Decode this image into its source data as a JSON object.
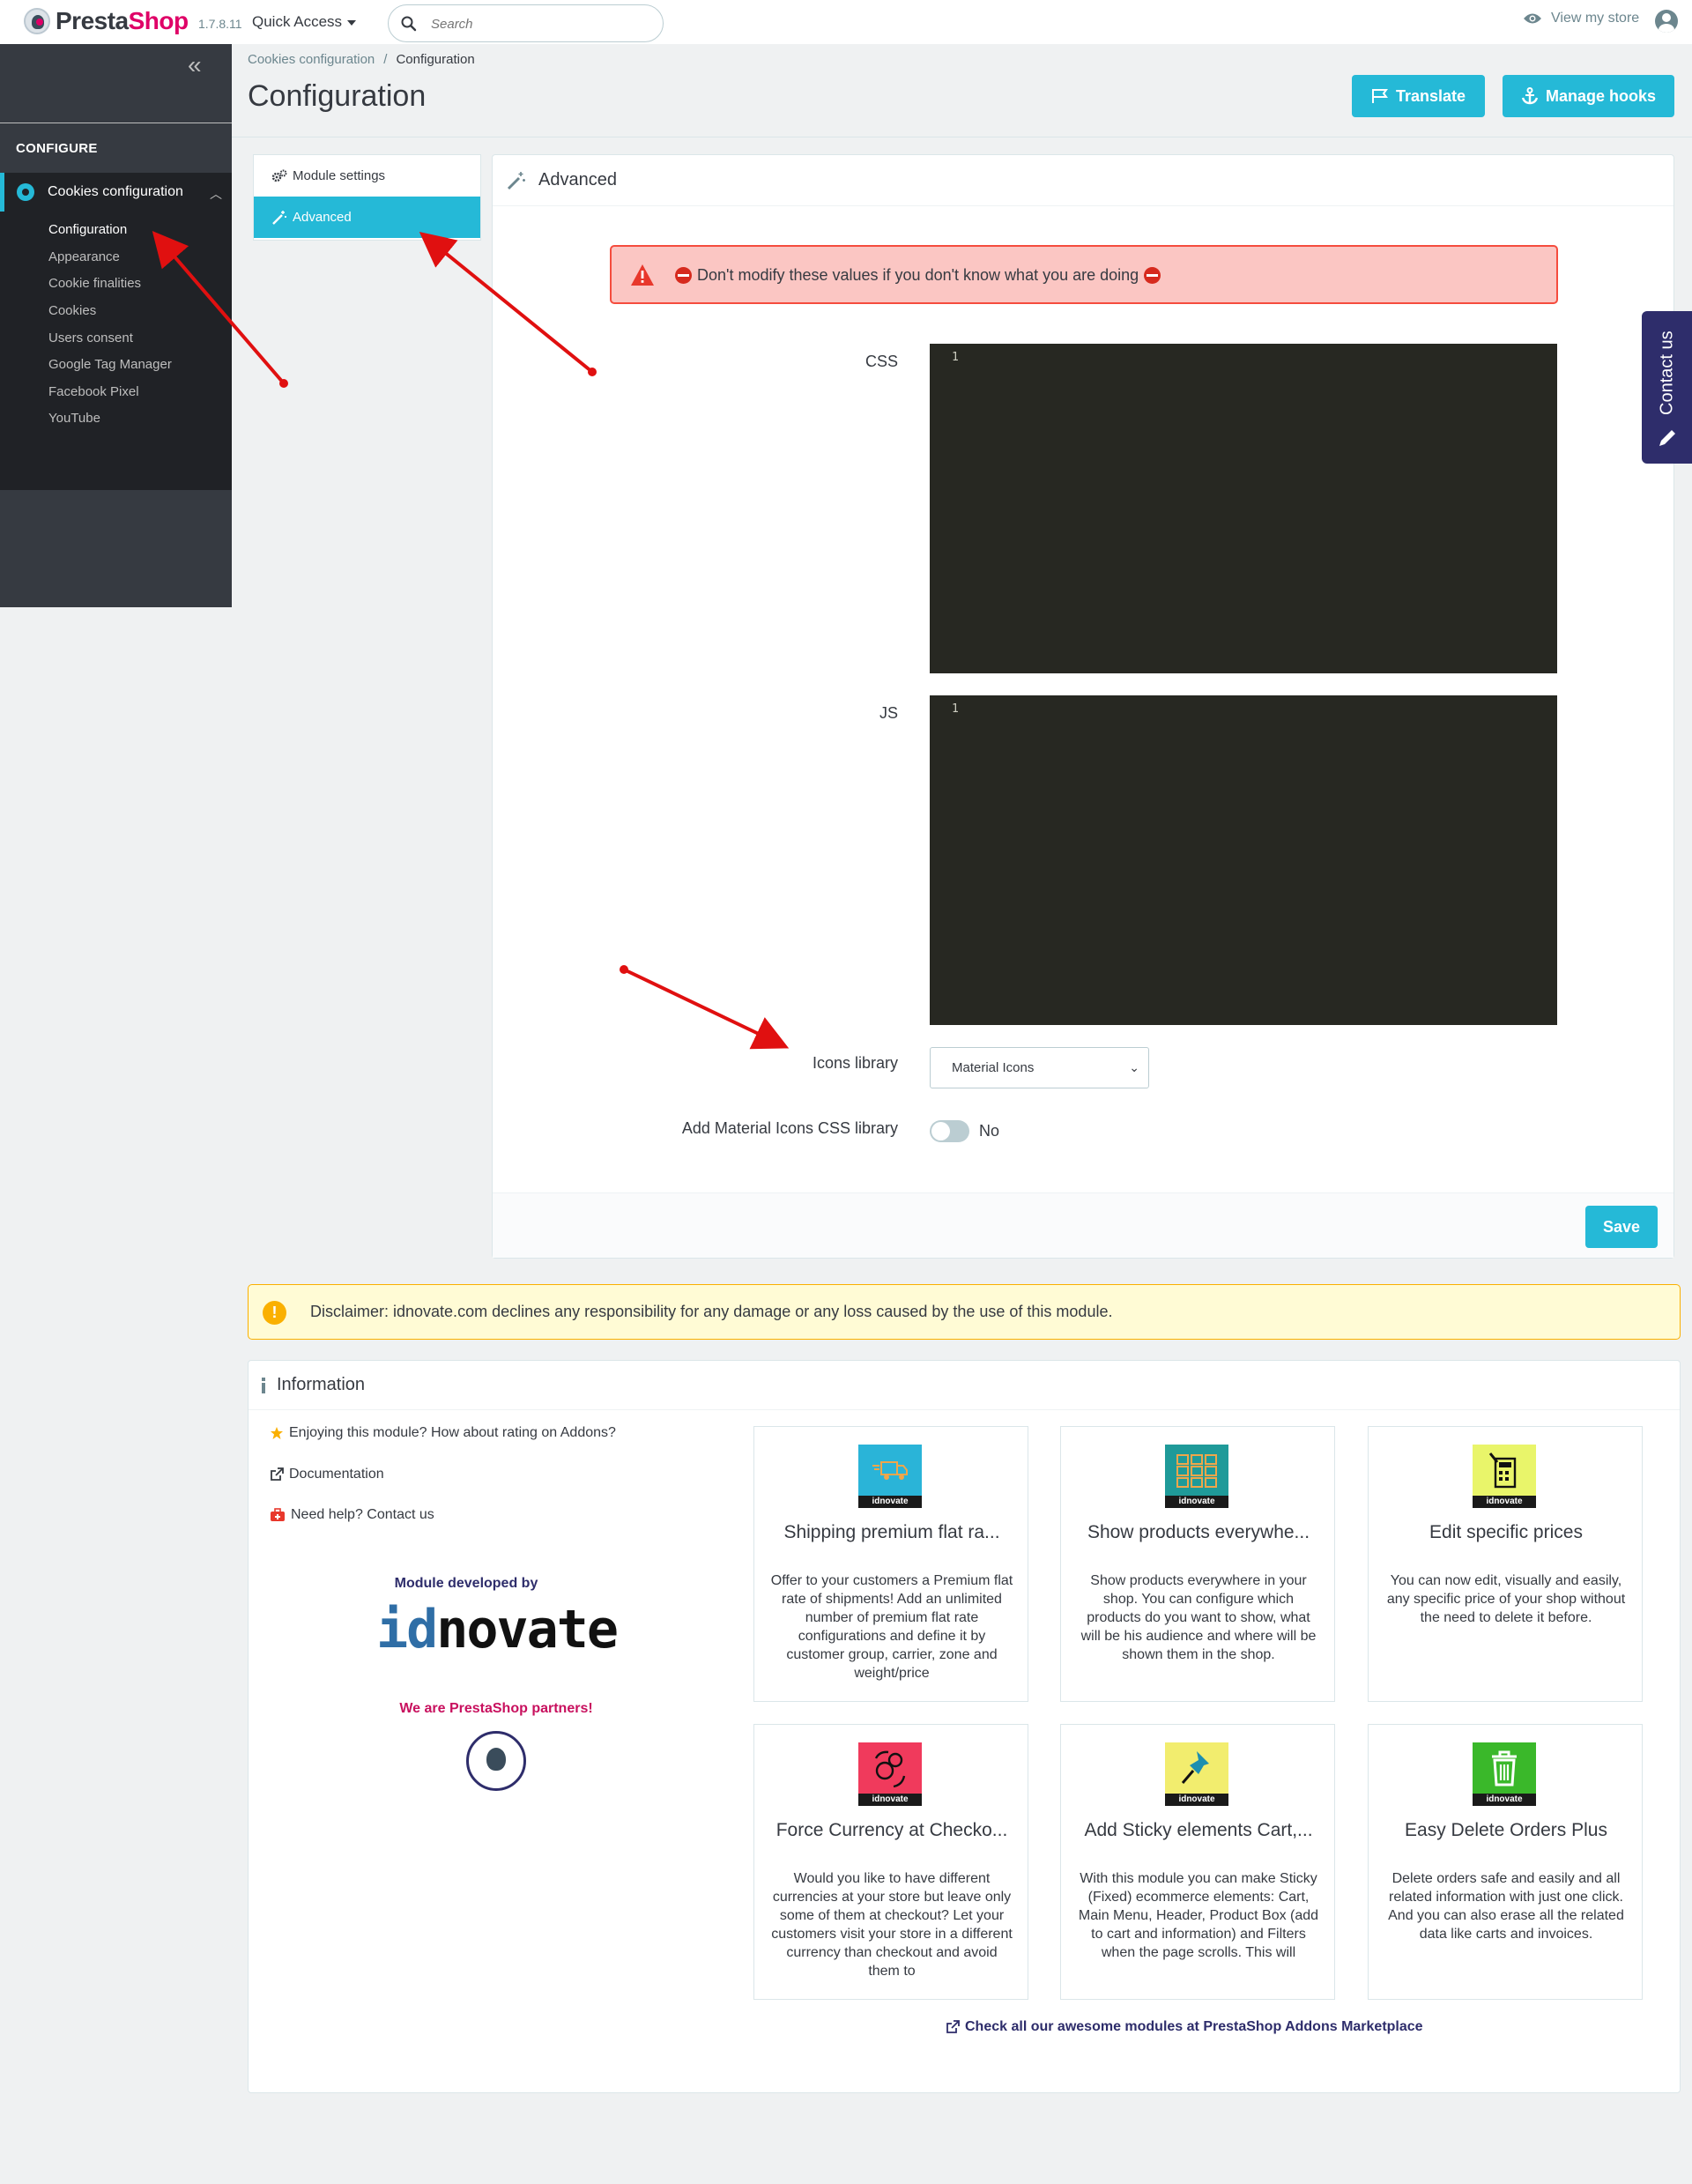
{
  "header": {
    "logo_part1": "Presta",
    "logo_part2": "Shop",
    "version": "1.7.8.11",
    "quick_access": "Quick Access",
    "search_placeholder": "Search",
    "view_store": "View my store"
  },
  "sidebar": {
    "section_title": "CONFIGURE",
    "parent_item": "Cookies configuration",
    "items": [
      {
        "label": "Configuration",
        "active": true
      },
      {
        "label": "Appearance"
      },
      {
        "label": "Cookie finalities"
      },
      {
        "label": "Cookies"
      },
      {
        "label": "Users consent"
      },
      {
        "label": "Google Tag Manager"
      },
      {
        "label": "Facebook Pixel"
      },
      {
        "label": "YouTube"
      }
    ]
  },
  "page": {
    "breadcrumb": [
      "Cookies configuration",
      "Configuration"
    ],
    "breadcrumb_separator": "/",
    "title": "Configuration",
    "translate_label": "Translate",
    "manage_hooks_label": "Manage hooks"
  },
  "tabs": [
    {
      "label": "Module settings"
    },
    {
      "label": "Advanced",
      "active": true
    }
  ],
  "advanced_panel": {
    "title": "Advanced",
    "warning": "Don't modify these values if you don't know what you are doing",
    "css_label": "CSS",
    "css_line": "1",
    "js_label": "JS",
    "js_line": "1",
    "icons_library_label": "Icons library",
    "icons_library_value": "Material Icons",
    "material_css_label": "Add Material Icons CSS library",
    "material_css_value": "No",
    "save_label": "Save"
  },
  "contact_tab": "Contact us",
  "disclaimer": "Disclaimer: idnovate.com declines any responsibility for any damage or any loss caused by the use of this module.",
  "information": {
    "title": "Information",
    "links": [
      {
        "label": "Enjoying this module? How about rating on Addons?",
        "icon": "star-icon"
      },
      {
        "label": "Documentation",
        "icon": "external-link-icon"
      },
      {
        "label": "Need help? Contact us",
        "icon": "medkit-icon"
      }
    ],
    "developed_by": "Module developed by",
    "brand_id": "id",
    "brand_rest": "novate",
    "partners": "We are PrestaShop partners!",
    "thumb_label": "idnovate",
    "modules": [
      {
        "title": "Shipping premium flat ra...",
        "desc": "Offer to your customers a Premium flat rate of shipments! Add an unlimited number of premium flat rate configurations and define it by customer group, carrier, zone and weight/price",
        "color": "#2ab4d8"
      },
      {
        "title": "Show products everywhe...",
        "desc": "Show products everywhere in your shop. You can configure which products do you want to show, what will be his audience and where will be shown them in the shop.",
        "color": "#1f9a99"
      },
      {
        "title": "Edit specific prices",
        "desc": "You can now edit, visually and easily, any specific price of your shop without the need to delete it before.",
        "color": "#e9f56a"
      },
      {
        "title": "Force Currency at Checko...",
        "desc": "Would you like to have different currencies at your store but leave only some of them at checkout? Let your customers visit your store in a different currency than checkout and avoid them to",
        "color": "#f03a5c"
      },
      {
        "title": "Add Sticky elements Cart,...",
        "desc": "With this module you can make Sticky (Fixed) ecommerce elements: Cart, Main Menu, Header, Product Box (add to cart and information) and Filters when the page scrolls. This will",
        "color": "#f2ed6e"
      },
      {
        "title": "Easy Delete Orders Plus",
        "desc": "Delete orders safe and easily and all related information with just one click. And you can also erase all the related data like carts and invoices.",
        "color": "#3ab82a"
      }
    ],
    "check_all": "Check all our awesome modules at PrestaShop Addons Marketplace"
  },
  "colors": {
    "primary": "#25b9d7",
    "sidebar_bg": "#363a41",
    "danger_bg": "#fbc6c3",
    "warning_bg": "#fffbd5",
    "annotation_arrow": "#e01010"
  }
}
